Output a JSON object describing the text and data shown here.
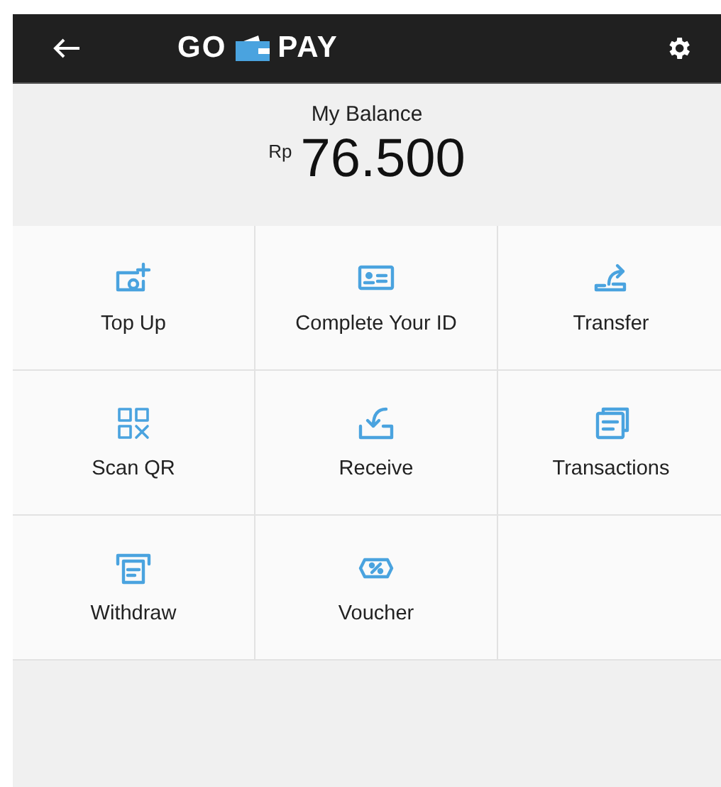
{
  "header": {
    "logo_left": "GO",
    "logo_right": "PAY"
  },
  "balance": {
    "label": "My Balance",
    "currency": "Rp",
    "amount": "76.500"
  },
  "tiles": [
    {
      "kind": "topup",
      "label": "Top Up"
    },
    {
      "kind": "id",
      "label": "Complete Your ID"
    },
    {
      "kind": "transfer",
      "label": "Transfer"
    },
    {
      "kind": "qr",
      "label": "Scan QR"
    },
    {
      "kind": "receive",
      "label": "Receive"
    },
    {
      "kind": "transactions",
      "label": "Transactions"
    },
    {
      "kind": "withdraw",
      "label": "Withdraw"
    },
    {
      "kind": "voucher",
      "label": "Voucher"
    },
    {
      "kind": "empty"
    }
  ]
}
